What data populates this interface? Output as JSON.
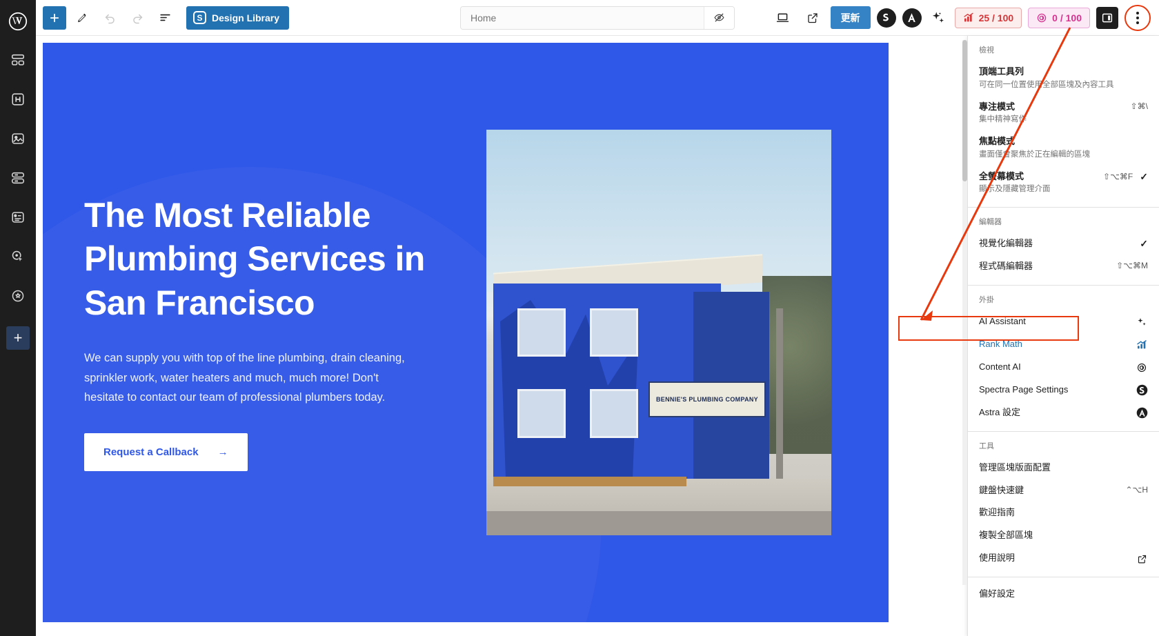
{
  "rail": {
    "logo": "wordpress-logo",
    "items": [
      {
        "name": "dashboard-blocks-icon"
      },
      {
        "name": "heading-block-icon"
      },
      {
        "name": "image-block-icon"
      },
      {
        "name": "stack-block-icon"
      },
      {
        "name": "card-block-icon"
      },
      {
        "name": "cursor-click-icon"
      },
      {
        "name": "settings-circle-icon"
      }
    ],
    "add_label": "+"
  },
  "toolbar": {
    "add_block_label": "+",
    "tools": {
      "edit": "pencil-icon",
      "undo": "undo-icon",
      "redo": "redo-icon",
      "list_view": "document-overview-icon"
    },
    "design_library_label": "Design Library",
    "design_library_badge": "S",
    "url_value": "Home",
    "url_placeholder": "Home",
    "preview_icon": "eye-off-icon",
    "device_icon": "desktop-icon",
    "external_icon": "external-link-icon",
    "update_label": "更新",
    "spectra_badge": "S",
    "astra_badge": "A",
    "ai_sparkle_icon": "sparkles-icon",
    "seo_score": "25 / 100",
    "ai_score": "0 / 100",
    "sidebar_toggle_icon": "settings-panel-icon",
    "options_icon": "kebab-menu-icon"
  },
  "hero": {
    "heading": "The Most Reliable Plumbing Services in San Francisco",
    "paragraph": "We can supply you with top of the line plumbing, drain cleaning, sprinkler work, water heaters and much, much more! Don't hesitate to contact our team of professional plumbers today.",
    "cta_label": "Request a Callback",
    "cta_arrow": "→",
    "image_sign_text": "BENNIE'S PLUMBING COMPANY",
    "bg_color": "#2f57e8"
  },
  "menu": {
    "groups": [
      {
        "label": "檢視",
        "items": [
          {
            "title": "頂端工具列",
            "desc": "可在同一位置使用全部區塊及內容工具",
            "shortcut": "",
            "check": false
          },
          {
            "title": "專注模式",
            "desc": "集中精神寫作",
            "shortcut": "⇧⌘\\",
            "check": false
          },
          {
            "title": "焦點模式",
            "desc": "畫面僅會聚焦於正在編輯的區塊",
            "shortcut": "",
            "check": false
          },
          {
            "title": "全螢幕模式",
            "desc": "顯示及隱藏管理介面",
            "shortcut": "⇧⌥⌘F",
            "check": true
          }
        ]
      },
      {
        "label": "編輯器",
        "items": [
          {
            "title": "視覺化編輯器",
            "desc": "",
            "shortcut": "",
            "check": true
          },
          {
            "title": "程式碼編輯器",
            "desc": "",
            "shortcut": "⇧⌥⌘M",
            "check": false
          }
        ]
      },
      {
        "label": "外掛",
        "items": [
          {
            "title": "AI Assistant",
            "desc": "",
            "shortcut": "",
            "badge": "sparkles-icon",
            "check": false
          },
          {
            "title": "Rank Math",
            "desc": "",
            "shortcut": "",
            "badge": "rankmath-icon",
            "check": false,
            "highlighted": true
          },
          {
            "title": "Content AI",
            "desc": "",
            "shortcut": "",
            "badge": "content-ai-icon",
            "check": false
          },
          {
            "title": "Spectra Page Settings",
            "desc": "",
            "shortcut": "",
            "badge": "spectra-icon",
            "check": false
          },
          {
            "title": "Astra 設定",
            "desc": "",
            "shortcut": "",
            "badge": "astra-icon",
            "check": false
          }
        ]
      },
      {
        "label": "工具",
        "items": [
          {
            "title": "管理區塊版面配置",
            "desc": "",
            "shortcut": "",
            "check": false
          },
          {
            "title": "鍵盤快速鍵",
            "desc": "",
            "shortcut": "⌃⌥H",
            "check": false
          },
          {
            "title": "歡迎指南",
            "desc": "",
            "shortcut": "",
            "check": false
          },
          {
            "title": "複製全部區塊",
            "desc": "",
            "shortcut": "",
            "check": false
          },
          {
            "title": "使用說明",
            "desc": "",
            "shortcut": "",
            "badge": "external-link-icon",
            "check": false
          }
        ]
      },
      {
        "label": "",
        "items": [
          {
            "title": "偏好設定",
            "desc": "",
            "shortcut": "",
            "check": false
          }
        ]
      }
    ]
  },
  "annotation": {
    "color": "#e8380d",
    "target": "Rank Math"
  }
}
